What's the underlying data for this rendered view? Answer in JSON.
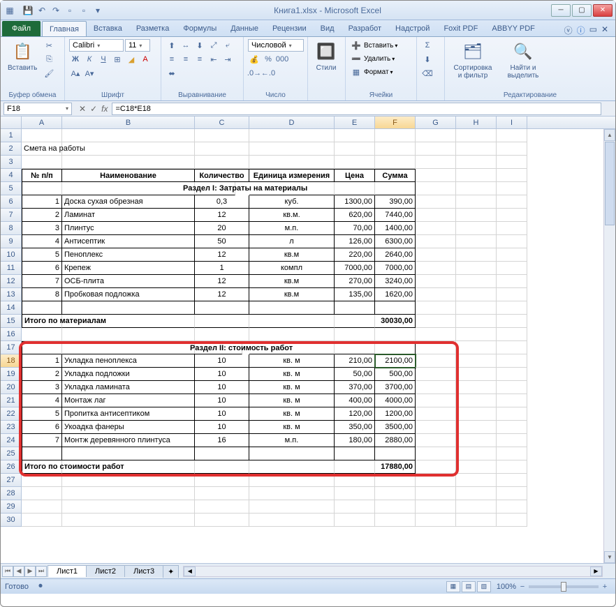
{
  "window": {
    "title": "Книга1.xlsx - Microsoft Excel"
  },
  "tabs": {
    "file": "Файл",
    "home": "Главная",
    "insert": "Вставка",
    "layout": "Разметка",
    "formulas": "Формулы",
    "data": "Данные",
    "review": "Рецензии",
    "view": "Вид",
    "developer": "Разработ",
    "addins": "Надстрой",
    "foxit": "Foxit PDF",
    "abbyy": "ABBYY PDF"
  },
  "ribbon": {
    "paste": "Вставить",
    "clipboard": "Буфер обмена",
    "font_name": "Calibri",
    "font_size": "11",
    "font_group": "Шрифт",
    "align_group": "Выравнивание",
    "number_format": "Числовой",
    "number_group": "Число",
    "styles": "Стили",
    "insert_btn": "Вставить",
    "delete_btn": "Удалить",
    "format_btn": "Формат",
    "cells_group": "Ячейки",
    "sort": "Сортировка и фильтр",
    "find": "Найти и выделить",
    "editing_group": "Редактирование"
  },
  "formula_bar": {
    "cell_ref": "F18",
    "formula": "=C18*E18"
  },
  "columns": [
    "A",
    "B",
    "C",
    "D",
    "E",
    "F",
    "G",
    "H",
    "I"
  ],
  "sheet": {
    "title": "Смета на работы",
    "headers": {
      "num": "№ п/п",
      "name": "Наименование",
      "qty": "Количество",
      "unit": "Единица измерения",
      "price": "Цена",
      "sum": "Сумма"
    },
    "section1": "Раздел I: Затраты на материалы",
    "rows1": [
      {
        "n": "1",
        "name": "Доска сухая обрезная",
        "qty": "0,3",
        "unit": "куб.",
        "price": "1300,00",
        "sum": "390,00"
      },
      {
        "n": "2",
        "name": "Ламинат",
        "qty": "12",
        "unit": "кв.м.",
        "price": "620,00",
        "sum": "7440,00"
      },
      {
        "n": "3",
        "name": "Плинтус",
        "qty": "20",
        "unit": "м.п.",
        "price": "70,00",
        "sum": "1400,00"
      },
      {
        "n": "4",
        "name": "Антисептик",
        "qty": "50",
        "unit": "л",
        "price": "126,00",
        "sum": "6300,00"
      },
      {
        "n": "5",
        "name": "Пеноплекс",
        "qty": "12",
        "unit": "кв.м",
        "price": "220,00",
        "sum": "2640,00"
      },
      {
        "n": "6",
        "name": "Крепеж",
        "qty": "1",
        "unit": "компл",
        "price": "7000,00",
        "sum": "7000,00"
      },
      {
        "n": "7",
        "name": "ОСБ-плита",
        "qty": "12",
        "unit": "кв.м",
        "price": "270,00",
        "sum": "3240,00"
      },
      {
        "n": "8",
        "name": "Пробковая подложка",
        "qty": "12",
        "unit": "кв.м",
        "price": "135,00",
        "sum": "1620,00"
      }
    ],
    "total1_label": "Итого по материалам",
    "total1_value": "30030,00",
    "section2": "Раздел II: стоимость работ",
    "rows2": [
      {
        "n": "1",
        "name": "Укладка пеноплекса",
        "qty": "10",
        "unit": "кв. м",
        "price": "210,00",
        "sum": "2100,00"
      },
      {
        "n": "2",
        "name": "Укладка подложки",
        "qty": "10",
        "unit": "кв. м",
        "price": "50,00",
        "sum": "500,00"
      },
      {
        "n": "3",
        "name": "Укладка  ламината",
        "qty": "10",
        "unit": "кв. м",
        "price": "370,00",
        "sum": "3700,00"
      },
      {
        "n": "4",
        "name": "Монтаж лаг",
        "qty": "10",
        "unit": "кв. м",
        "price": "400,00",
        "sum": "4000,00"
      },
      {
        "n": "5",
        "name": "Пропитка антисептиком",
        "qty": "10",
        "unit": "кв. м",
        "price": "120,00",
        "sum": "1200,00"
      },
      {
        "n": "6",
        "name": "Укоадка фанеры",
        "qty": "10",
        "unit": "кв. м",
        "price": "350,00",
        "sum": "3500,00"
      },
      {
        "n": "7",
        "name": "Монтж деревянного плинтуса",
        "qty": "16",
        "unit": "м.п.",
        "price": "180,00",
        "sum": "2880,00"
      }
    ],
    "total2_label": "Итого по стоимости работ",
    "total2_value": "17880,00"
  },
  "sheets": {
    "s1": "Лист1",
    "s2": "Лист2",
    "s3": "Лист3"
  },
  "status": {
    "ready": "Готово",
    "zoom": "100%"
  }
}
